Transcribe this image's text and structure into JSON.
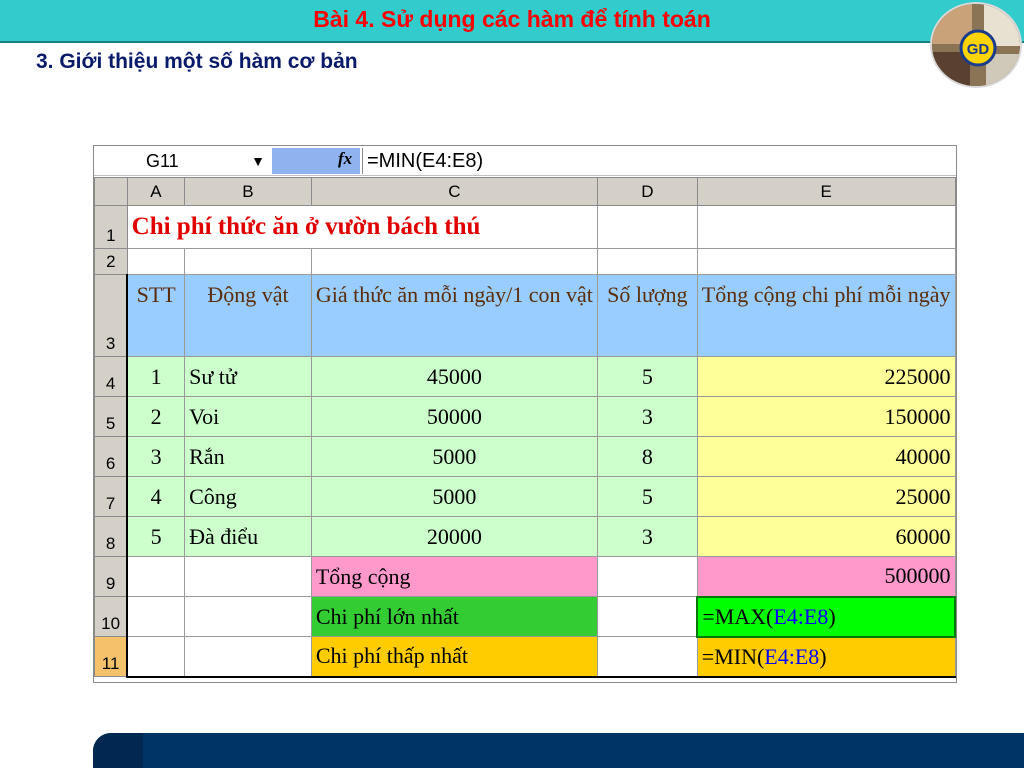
{
  "slide": {
    "title": "Bài 4. Sử dụng các hàm để tính toán",
    "subtitle": "3. Giới thiệu một số hàm cơ bản"
  },
  "formula_bar": {
    "name_box": "G11",
    "fx_icon": "fx",
    "formula": "=MIN(E4:E8)"
  },
  "columns": [
    "A",
    "B",
    "C",
    "D",
    "E"
  ],
  "rows": [
    "1",
    "2",
    "3",
    "4",
    "5",
    "6",
    "7",
    "8",
    "9",
    "10",
    "11"
  ],
  "sheet_title": "Chi phí thức ăn ở vườn bách thú",
  "headers": {
    "stt": "STT",
    "animal": "Động vật",
    "price": "Giá thức ăn mỗi ngày/1 con vật",
    "qty": "Số lượng",
    "total": "Tổng cộng chi phí mỗi ngày"
  },
  "records": [
    {
      "stt": "1",
      "animal": "Sư  tử",
      "price": "45000",
      "qty": "5",
      "total": "225000"
    },
    {
      "stt": "2",
      "animal": "Voi",
      "price": "50000",
      "qty": "3",
      "total": "150000"
    },
    {
      "stt": "3",
      "animal": "Rắn",
      "price": "5000",
      "qty": "8",
      "total": "40000"
    },
    {
      "stt": "4",
      "animal": "Công",
      "price": "5000",
      "qty": "5",
      "total": "25000"
    },
    {
      "stt": "5",
      "animal": "Đà điểu",
      "price": "20000",
      "qty": "3",
      "total": "60000"
    }
  ],
  "summary": {
    "total_label": "Tổng cộng",
    "total_value": "500000",
    "max_label": "Chi phí lớn nhất",
    "max_fn": "=MAX(",
    "max_ref": "E4:E8",
    "max_close": ")",
    "min_label": "Chi phí thấp nhất",
    "min_fn": "=MIN(",
    "min_ref": "E4:E8",
    "min_close": ")"
  },
  "colors": {
    "title_red": "#ff0000",
    "header_teal": "#33cccc",
    "footer_navy": "#003366"
  }
}
